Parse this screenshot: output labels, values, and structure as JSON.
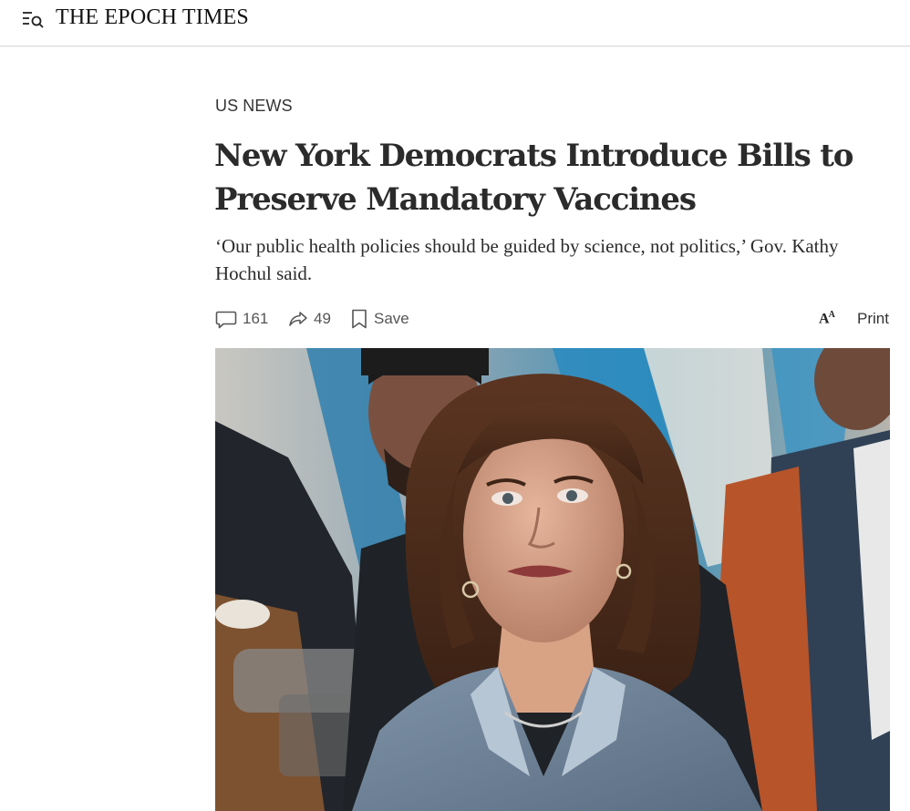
{
  "header": {
    "brand": "THE EPOCH TIMES",
    "menu_icon": "menu-search-icon"
  },
  "article": {
    "section": "US NEWS",
    "headline": "New York Democrats Introduce Bills to Preserve Mandatory Vaccines",
    "subhead": "‘Our public health policies should be guided by science, not politics,’ Gov. Kathy Hochul said.",
    "actions": {
      "comments_count": "161",
      "shares_count": "49",
      "save_label": "Save",
      "font_size_icon": "font-size-icon",
      "print_label": "Print"
    },
    "hero_image": {
      "subject": "photo-woman-press-conference"
    }
  },
  "colors": {
    "text": "#222222",
    "muted": "#555555",
    "divider": "#d9d9d9"
  }
}
